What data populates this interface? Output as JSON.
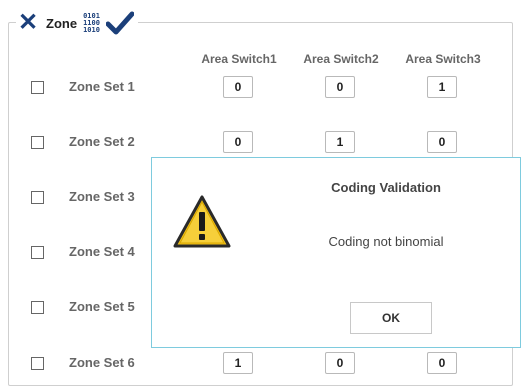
{
  "panel": {
    "title": "Zone",
    "binary_icon_lines": [
      "0101",
      "1100",
      "1010"
    ]
  },
  "columns": [
    "Area Switch1",
    "Area Switch2",
    "Area Switch3"
  ],
  "rows": [
    {
      "label": "Zone Set 1",
      "values": [
        "0",
        "0",
        "1"
      ]
    },
    {
      "label": "Zone Set 2",
      "values": [
        "0",
        "1",
        "0"
      ]
    },
    {
      "label": "Zone Set 3",
      "values": [
        "",
        "",
        ""
      ]
    },
    {
      "label": "Zone Set 4",
      "values": [
        "",
        "",
        ""
      ]
    },
    {
      "label": "Zone Set 5",
      "values": [
        "",
        "",
        ""
      ]
    },
    {
      "label": "Zone Set 6",
      "values": [
        "1",
        "0",
        "0"
      ]
    }
  ],
  "dialog": {
    "title": "Coding Validation",
    "message": "Coding not binomial",
    "ok_label": "OK"
  },
  "colors": {
    "icon_blue": "#1b3f7a",
    "dialog_border": "#7ecbde",
    "warning_yellow": "#f2c21b"
  }
}
